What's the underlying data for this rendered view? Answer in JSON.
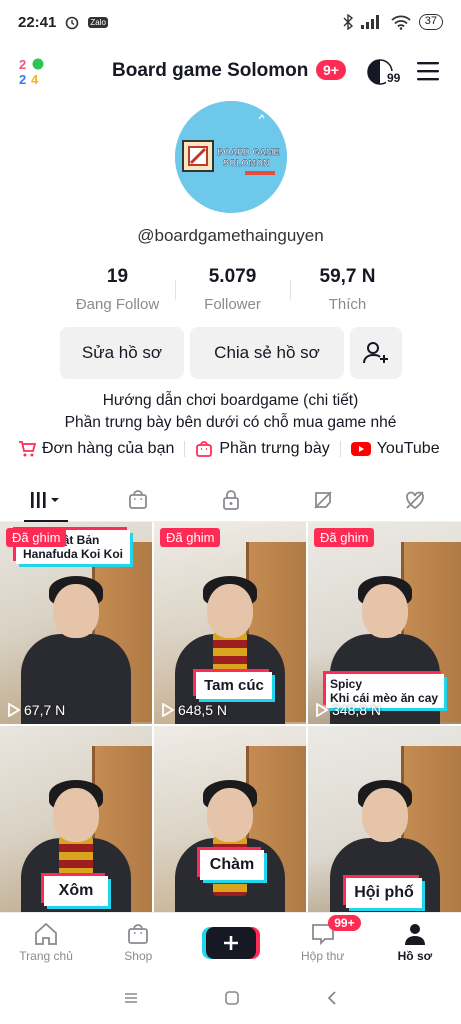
{
  "status_bar": {
    "time": "22:41",
    "battery": "37",
    "zalo_label": "Zalo"
  },
  "header": {
    "profile_name": "Board game Solomon",
    "notif_count": "9+",
    "avatar_badge": "99"
  },
  "profile": {
    "avatar_text_line1": "BOARD GAME",
    "avatar_text_line2": "SOLOMON",
    "handle": "@boardgamethainguyen",
    "stats": [
      {
        "value": "19",
        "label": "Đang Follow"
      },
      {
        "value": "5.079",
        "label": "Follower"
      },
      {
        "value": "59,7 N",
        "label": "Thích"
      }
    ],
    "buttons": {
      "edit": "Sửa hồ sơ",
      "share": "Chia sẻ hồ sơ"
    },
    "bio_line1": "Hướng dẫn chơi boardgame (chi tiết)",
    "bio_line2": "Phần trưng bày bên dưới có chỗ mua game nhé",
    "links": {
      "orders": "Đơn hàng của bạn",
      "showcase": "Phần trưng bày",
      "youtube": "YouTube"
    }
  },
  "tabs": [
    "videos-grid",
    "shop",
    "private",
    "reposts",
    "liked"
  ],
  "videos": [
    {
      "pinned": "Đã ghim",
      "caption": "Nhật Bản\nHanafuda Koi Koi",
      "views": "67,7 N"
    },
    {
      "pinned": "Đã ghim",
      "caption": "Tam cúc",
      "views": "648,5 N"
    },
    {
      "pinned": "Đã ghim",
      "caption": "Spicy\nKhi cái mèo ăn cay",
      "views": "348,8 N"
    },
    {
      "pinned": "",
      "caption": "Xôm",
      "views": ""
    },
    {
      "pinned": "",
      "caption": "Chàm",
      "views": ""
    },
    {
      "pinned": "",
      "caption": "Hội phố",
      "views": ""
    }
  ],
  "bottom_nav": {
    "home": "Trang chủ",
    "shop": "Shop",
    "inbox": "Hộp thư",
    "inbox_badge": "99+",
    "profile": "Hồ sơ"
  },
  "colors": {
    "accent": "#fe2c55",
    "cyan": "#20d5ec",
    "avatar_bg": "#6ec8e9"
  }
}
